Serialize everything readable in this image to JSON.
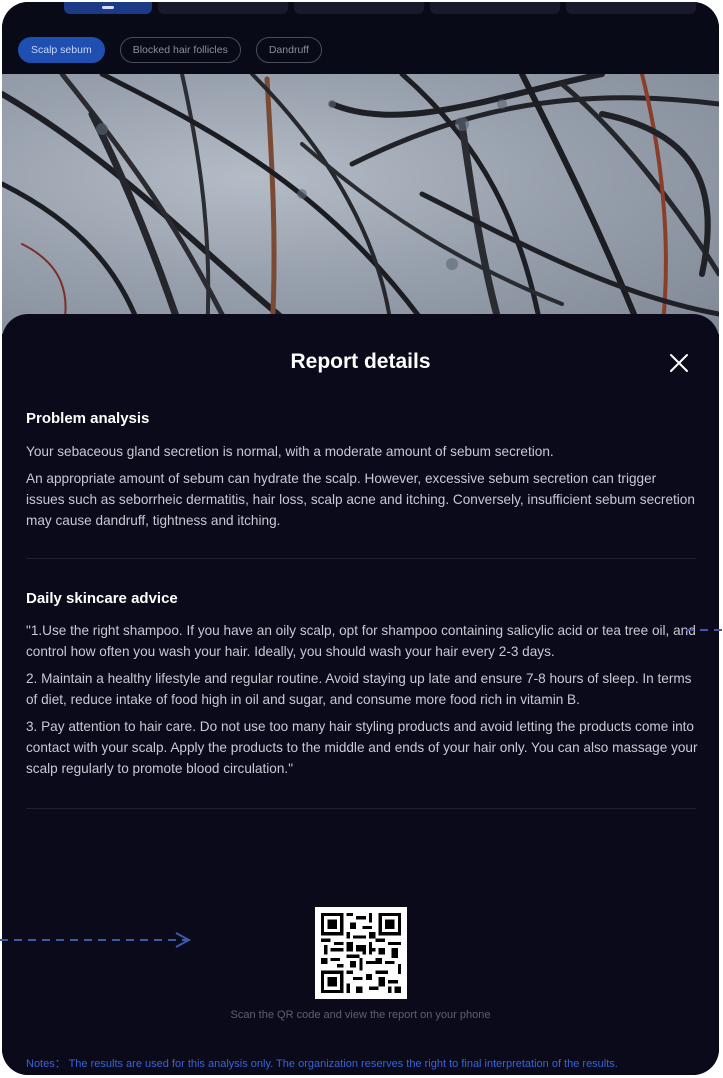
{
  "filter_chips": [
    {
      "label": "Scalp sebum",
      "active": true
    },
    {
      "label": "Blocked hair follicles",
      "active": false
    },
    {
      "label": "Dandruff",
      "active": false
    }
  ],
  "sheet": {
    "title": "Report details",
    "close_icon": "close-icon"
  },
  "problem_analysis": {
    "heading": "Problem analysis",
    "paragraphs": [
      "Your sebaceous gland secretion is normal, with a moderate amount of sebum secretion.",
      "An appropriate amount of sebum can hydrate the scalp. However, excessive sebum secretion can trigger issues such as seborrheic dermatitis, hair loss, scalp acne and itching. Conversely, insufficient sebum secretion may cause dandruff, tightness and itching."
    ]
  },
  "skincare_advice": {
    "heading": "Daily skincare advice",
    "paragraphs": [
      "\"1.Use the right shampoo. If you have an oily scalp, opt for shampoo containing salicylic acid or tea tree oil, and control how often you wash your hair. Ideally, you should wash your hair every 2-3 days.",
      "2. Maintain a healthy lifestyle and regular routine. Avoid staying up late and ensure 7-8 hours of sleep. In terms of diet, reduce intake of food high in oil and sugar, and consume more food rich in vitamin B.",
      "3. Pay attention to hair care.  Do not use too many hair styling products and avoid letting the products come into contact with your scalp. Apply the products to the middle and ends of your hair only. You can also massage your scalp regularly to promote blood circulation.\""
    ]
  },
  "qr": {
    "icon": "qr-code-icon",
    "caption": "Scan the QR code and view the report on your phone"
  },
  "notes": "Notes： The results are used for this analysis only. The organization reserves the right to final interpretation of the results.",
  "colors": {
    "accent": "#1e4fb1",
    "background": "#0a0a1a",
    "notes": "#3a63d8"
  }
}
